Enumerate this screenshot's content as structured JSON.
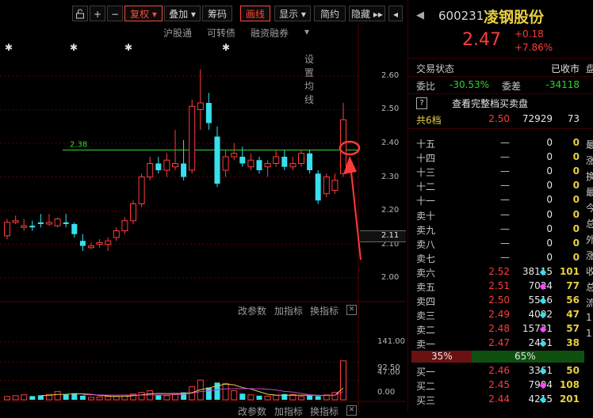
{
  "toolbar": {
    "buttons": [
      {
        "label": "复权",
        "active": true
      },
      {
        "label": "叠加"
      },
      {
        "label": "筹码"
      },
      {
        "label": "画线",
        "active": true
      },
      {
        "label": "显示"
      },
      {
        "label": "简约"
      },
      {
        "label": "隐藏"
      }
    ]
  },
  "subtoolbar": [
    "沪股通",
    "可转债",
    "融资融券",
    "设置均线"
  ],
  "price_axis": [
    "2.60",
    "2.50",
    "2.40",
    "2.30",
    "2.20",
    "2.10",
    "2.00"
  ],
  "current_price_tag": "2.11",
  "horizontal_line": {
    "label": "2.38",
    "value": 2.38
  },
  "indicator_actions": [
    "改参数",
    "加指标",
    "换指标"
  ],
  "volume_axis": [
    "141.00",
    "92.50",
    "47.00",
    "0.00"
  ],
  "quote": {
    "code": "600231",
    "name": "凌钢股份",
    "price": "2.47",
    "change": "+0.18",
    "change_pct": "+7.86%",
    "status_label": "交易状态",
    "status_value": "已收市",
    "ratio_label": "委比",
    "ratio_value": "-30.53%",
    "diff_label": "委差",
    "diff_value": "-34118",
    "full_book_label": "查看完整档买卖盘",
    "total_levels_label": "共6档",
    "total_price": "2.50",
    "total_volume": "72929",
    "total_count": "73"
  },
  "sell_rows": [
    {
      "name": "十五",
      "price": "—",
      "vol": "0",
      "cnt": "0"
    },
    {
      "name": "十四",
      "price": "—",
      "vol": "0",
      "cnt": "0"
    },
    {
      "name": "十三",
      "price": "—",
      "vol": "0",
      "cnt": "0"
    },
    {
      "name": "十二",
      "price": "—",
      "vol": "0",
      "cnt": "0"
    },
    {
      "name": "十一",
      "price": "—",
      "vol": "0",
      "cnt": "0"
    },
    {
      "name": "卖十",
      "price": "—",
      "vol": "0",
      "cnt": "0"
    },
    {
      "name": "卖九",
      "price": "—",
      "vol": "0",
      "cnt": "0"
    },
    {
      "name": "卖八",
      "price": "—",
      "vol": "0",
      "cnt": "0"
    },
    {
      "name": "卖七",
      "price": "—",
      "vol": "0",
      "cnt": "0"
    },
    {
      "name": "卖六",
      "price": "2.52",
      "vol": "38115",
      "cnt": "101"
    },
    {
      "name": "卖五",
      "price": "2.51",
      "vol": "7024",
      "cnt": "77"
    },
    {
      "name": "卖四",
      "price": "2.50",
      "vol": "5516",
      "cnt": "56"
    },
    {
      "name": "卖三",
      "price": "2.49",
      "vol": "4092",
      "cnt": "47"
    },
    {
      "name": "卖二",
      "price": "2.48",
      "vol": "15731",
      "cnt": "57"
    },
    {
      "name": "卖一",
      "price": "2.47",
      "vol": "2451",
      "cnt": "38"
    }
  ],
  "split_bar": {
    "left": "35%",
    "right": "65%",
    "left_fraction": 0.35
  },
  "buy_rows": [
    {
      "name": "买一",
      "price": "2.46",
      "vol": "3361",
      "cnt": "50"
    },
    {
      "name": "买二",
      "price": "2.45",
      "vol": "7904",
      "cnt": "108"
    },
    {
      "name": "买三",
      "price": "2.44",
      "vol": "4215",
      "cnt": "201"
    }
  ],
  "colors": {
    "up": "#ff3c3c",
    "down": "#36e0ee",
    "line": "#2fd82f",
    "accent": "#ff4a3a"
  }
}
